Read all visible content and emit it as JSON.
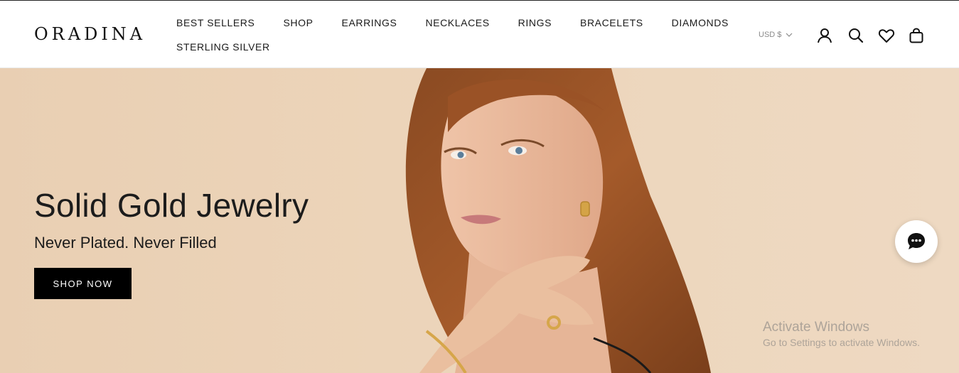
{
  "brand": {
    "logo": "ORADINA"
  },
  "nav": {
    "row1": [
      "BEST SELLERS",
      "SHOP",
      "EARRINGS",
      "NECKLACES",
      "RINGS",
      "BRACELETS",
      "DIAMONDS"
    ],
    "row2": [
      "STERLING SILVER"
    ]
  },
  "header": {
    "currency": "USD $",
    "icons": [
      "account-icon",
      "search-icon",
      "wishlist-heart-icon",
      "cart-bag-icon"
    ]
  },
  "hero": {
    "title": "Solid Gold Jewelry",
    "subtitle": "Never Plated. Never Filled",
    "cta": "SHOP NOW",
    "background_color": "#ecd4b9"
  },
  "chat": {
    "icon": "chat-bubble-icon"
  },
  "watermark": {
    "title": "Activate Windows",
    "subtitle": "Go to Settings to activate Windows."
  }
}
